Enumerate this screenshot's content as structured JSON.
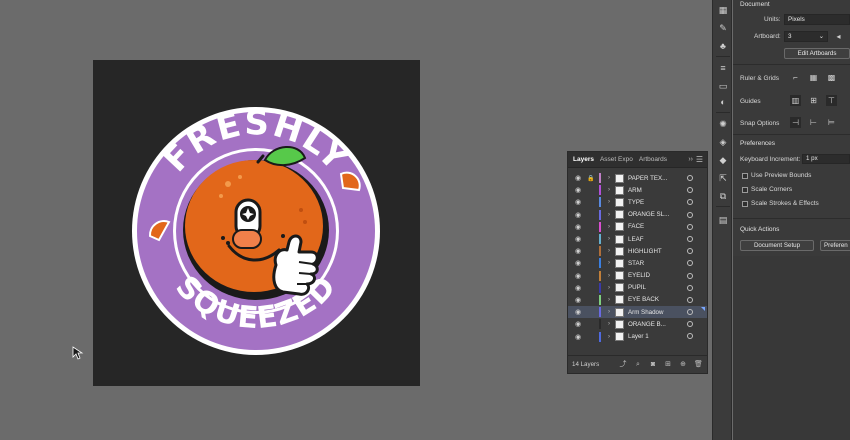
{
  "artwork": {
    "top_text": "FRESHLY",
    "bottom_text": "SQUEEZED",
    "colors": {
      "background": "#262626",
      "ring": "#a472c4",
      "orange": "#e2671a",
      "leaf": "#57c94a"
    }
  },
  "layers_panel": {
    "tabs": [
      "Layers",
      "Asset Expo",
      "Artboards"
    ],
    "more_label": "››",
    "layers": [
      {
        "name": "PAPER TEX...",
        "color": "#c07fc7",
        "locked": true
      },
      {
        "name": "ARM",
        "color": "#b24fd8"
      },
      {
        "name": "TYPE",
        "color": "#5a8ae0"
      },
      {
        "name": "ORANGE SL...",
        "color": "#6a6ae0"
      },
      {
        "name": "FACE",
        "color": "#d84fd0"
      },
      {
        "name": "LEAF",
        "color": "#66b0cf"
      },
      {
        "name": "HIGHLIGHT",
        "color": "#b06f3a"
      },
      {
        "name": "STAR",
        "color": "#3b7fe0"
      },
      {
        "name": "EYELID",
        "color": "#c07f3a"
      },
      {
        "name": "PUPIL",
        "color": "#3a3aa8"
      },
      {
        "name": "EYE BACK",
        "color": "#7fcf7f"
      },
      {
        "name": "Arm Shadow",
        "color": "#6a6ae0",
        "selected": true
      },
      {
        "name": "ORANGE B...",
        "color": "#2a2a2a"
      },
      {
        "name": "Layer 1",
        "color": "#4f6adf"
      }
    ],
    "count_label": "14 Layers"
  },
  "properties": {
    "document_header": "Document",
    "units_label": "Units:",
    "units_value": "Pixels",
    "artboard_label": "Artboard:",
    "artboard_value": "3",
    "edit_artboards": "Edit Artboards",
    "ruler_grids": "Ruler & Grids",
    "guides": "Guides",
    "snap_options": "Snap Options",
    "preferences_header": "Preferences",
    "keyboard_increment_label": "Keyboard Increment:",
    "keyboard_increment_value": "1 px",
    "use_preview_bounds": "Use Preview Bounds",
    "scale_corners": "Scale Corners",
    "scale_strokes": "Scale Strokes & Effects",
    "quick_actions_header": "Quick Actions",
    "document_setup": "Document Setup",
    "preferences_button": "Preferen"
  }
}
